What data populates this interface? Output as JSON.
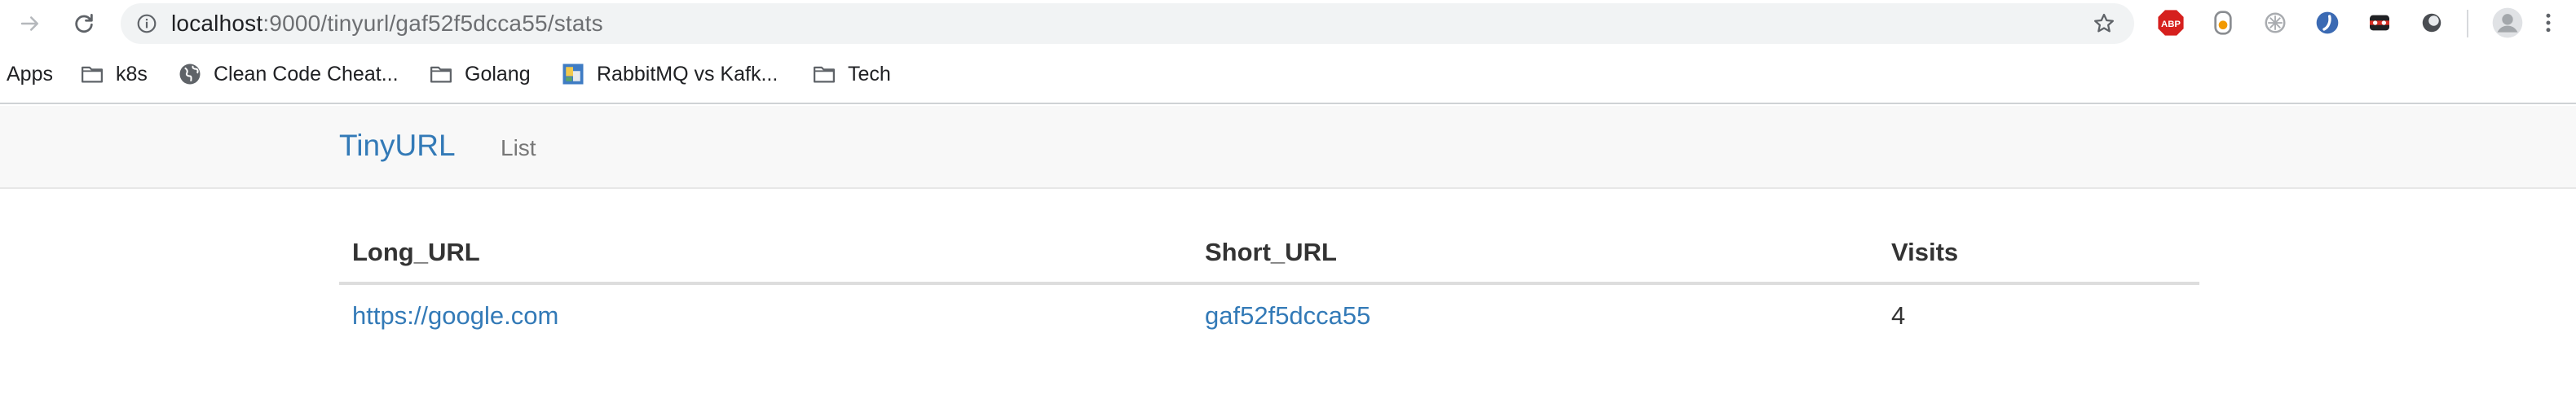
{
  "browser": {
    "address": {
      "host": "localhost",
      "path": ":9000/tinyurl/gaf52f5dcca55/stats"
    },
    "extensions": [
      "abp-icon",
      "extension-icon-2",
      "extension-icon-3",
      "extension-icon-4",
      "extension-icon-5",
      "extension-icon-6"
    ]
  },
  "bookmarks": [
    {
      "label": "Apps",
      "icon": "apps-icon"
    },
    {
      "label": "k8s",
      "icon": "folder-icon"
    },
    {
      "label": "Clean Code Cheat...",
      "icon": "globe-icon"
    },
    {
      "label": "Golang",
      "icon": "folder-icon"
    },
    {
      "label": "RabbitMQ vs Kafk...",
      "icon": "site-icon"
    },
    {
      "label": "Tech",
      "icon": "folder-icon"
    }
  ],
  "navbar": {
    "brand": "TinyURL",
    "links": [
      "List"
    ]
  },
  "table": {
    "headers": [
      "Long_URL",
      "Short_URL",
      "Visits"
    ],
    "rows": [
      {
        "long_url": "https://google.com",
        "short_url": "gaf52f5dcca55",
        "visits": "4"
      }
    ]
  },
  "colors": {
    "link": "#337ab7",
    "navbar_bg": "#f8f8f8",
    "abp_red": "#d6201e"
  }
}
